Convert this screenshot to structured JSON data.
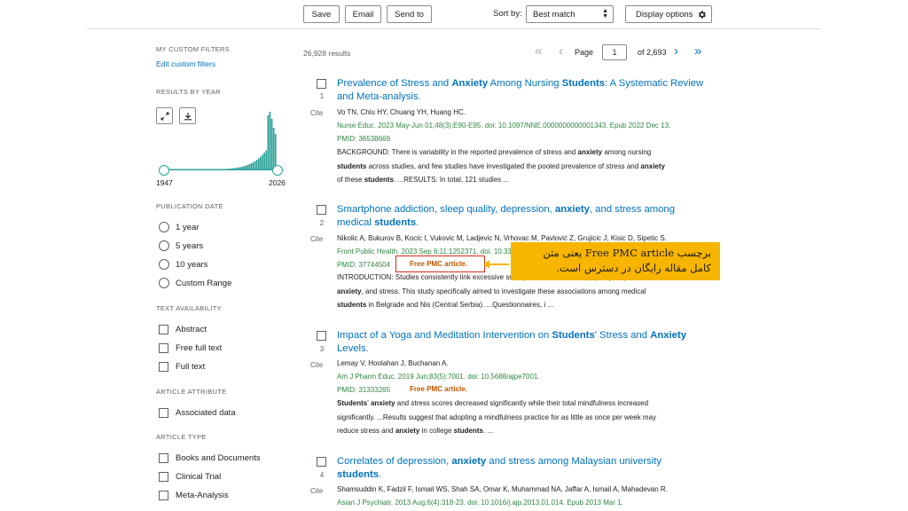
{
  "toolbar": {
    "save": "Save",
    "email": "Email",
    "send_to": "Send to",
    "sort_label": "Sort by:",
    "sort_value": "Best match",
    "display_options": "Display options"
  },
  "sidebar": {
    "custom_filters_heading": "MY CUSTOM FILTERS",
    "edit_filters": "Edit custom filters",
    "results_by_year": "RESULTS BY YEAR",
    "year_start": "1947",
    "year_end": "2026",
    "pub_date_heading": "PUBLICATION DATE",
    "pub_date_options": [
      "1 year",
      "5 years",
      "10 years",
      "Custom Range"
    ],
    "text_avail_heading": "TEXT AVAILABILITY",
    "text_avail_options": [
      "Abstract",
      "Free full text",
      "Full text"
    ],
    "article_attr_heading": "ARTICLE ATTRIBUTE",
    "article_attr_options": [
      "Associated data"
    ],
    "article_type_heading": "ARTICLE TYPE",
    "article_type_options": [
      "Books and Documents",
      "Clinical Trial",
      "Meta-Analysis"
    ]
  },
  "results_count": "26,928 results",
  "pager": {
    "page_label": "Page",
    "page_value": "1",
    "of_total": "of 2,693"
  },
  "cite_label": "Cite",
  "results": [
    {
      "num": "1",
      "authors": "Vo TN, Chiu HY, Chuang YH, Huang HC.",
      "journal": "Nurse Educ. 2023 May-Jun 01;48(3):E90-E95. doi: 10.1097/NNE.0000000000001343. Epub 2022 Dec 13.",
      "pmid": "PMID: 36538669",
      "free": "",
      "snippet_lines": [
        "BACKGROUND: There is variability in the reported prevalence of stress and ",
        "anxiety",
        " among nursing"
      ]
    },
    {
      "num": "2",
      "authors": "Nikolic A, Bukurov B, Kocic I, Vukovic M, Ladjevic N, Vrhovac M, Pavlović Z, Grujicic J, Kisic D, Sipetic S.",
      "journal": "Front Public Health. 2023 Sep 6;11:1252371. doi: 10.3389/fpubh.2023.1252371.",
      "pmid": "PMID: 37744504",
      "free": "Free PMC article."
    },
    {
      "num": "3",
      "authors": "Lemay V, Hoolahan J, Buchanan A.",
      "journal": "Am J Pharm Educ. 2019 Jun;83(5):7001. doi: 10.5688/ajpe7001.",
      "pmid": "PMID: 31333265",
      "free": "Free PMC article."
    },
    {
      "num": "4",
      "authors": "Shamsuddin K, Fadzil F, Ismail WS, Shah SA, Omar K, Muhammad NA, Jaffar A, Ismail A, Mahadevan R.",
      "journal": "Asian J Psychiatr. 2013 Aug;6(4):318-23. doi: 10.1016/j.ajp.2013.01.014. Epub 2013 Mar 1."
    }
  ],
  "callout": {
    "line1": "برچسب Free PMC article یعنی متن",
    "line2": "کامل مقاله رایگان در دسترس است."
  },
  "colors": {
    "link": "#0071bc",
    "journal": "#2e8540",
    "free_pmc": "#c05600",
    "callout_bg": "#f7b500",
    "highlight_border": "#d62d20"
  }
}
